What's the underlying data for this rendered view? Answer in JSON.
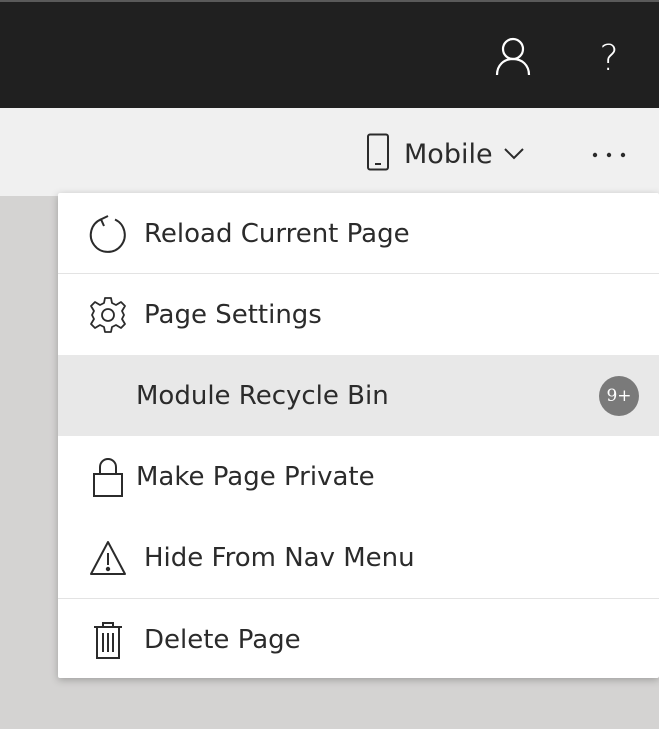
{
  "header": {
    "icons": [
      "user-icon",
      "help-icon"
    ],
    "help_glyph": "?"
  },
  "toolbar": {
    "device_label": "Mobile",
    "device_icon": "mobile-phone-icon",
    "more_icon": "ellipsis-icon"
  },
  "menu": {
    "items": [
      {
        "label": "Reload Current Page",
        "icon": "reload-icon"
      },
      {
        "label": "Page Settings",
        "icon": "gear-icon"
      },
      {
        "label": "Module Recycle Bin",
        "icon": "",
        "badge": "9+"
      },
      {
        "label": "Make Page Private",
        "icon": "lock-icon"
      },
      {
        "label": "Hide From Nav Menu",
        "icon": "warning-icon"
      },
      {
        "label": "Delete Page",
        "icon": "trash-icon"
      }
    ]
  },
  "colors": {
    "topbar_bg": "#202020",
    "toolbar_bg": "#f0f0f0",
    "page_bg": "#d4d3d2",
    "menu_highlight": "#e8e8e8",
    "badge_bg": "#7a7a7a"
  }
}
